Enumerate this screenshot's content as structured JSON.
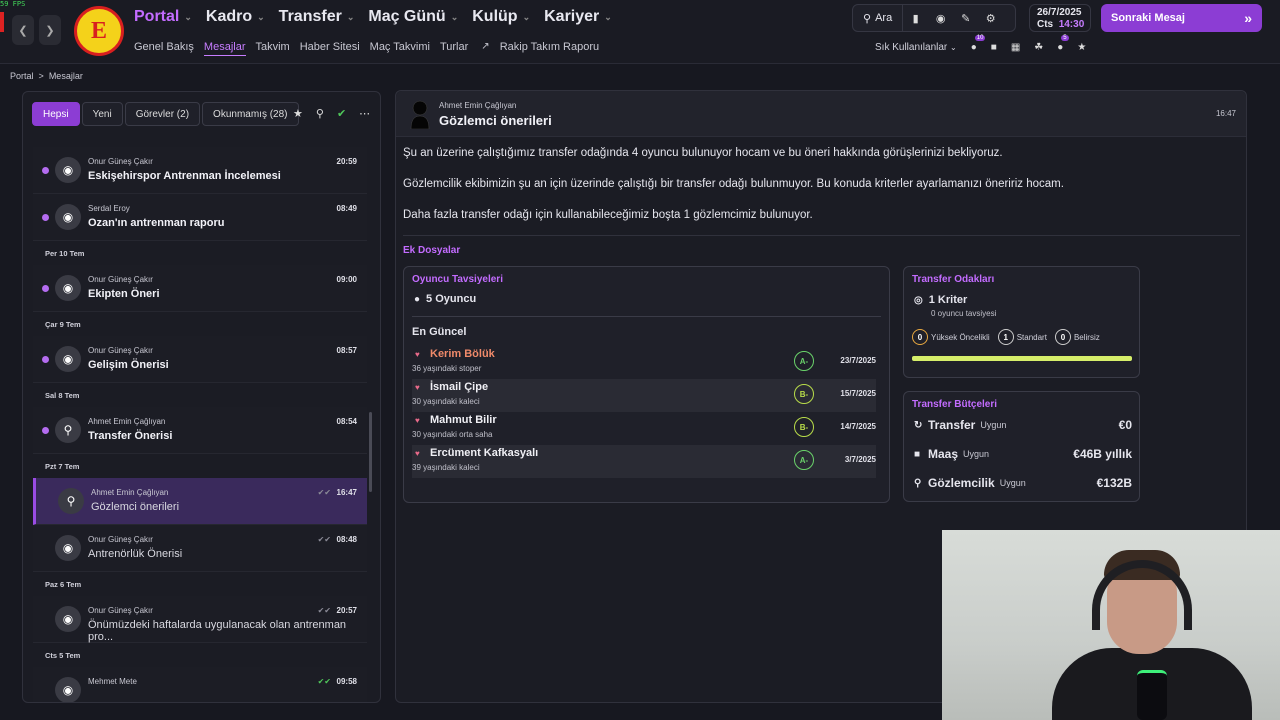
{
  "fps": "59 FPS",
  "nav": {
    "back_icon": "chevron-left-icon",
    "forward_icon": "chevron-right-icon",
    "main": [
      {
        "label": "Portal",
        "active": true
      },
      {
        "label": "Kadro",
        "active": false
      },
      {
        "label": "Transfer",
        "active": false
      },
      {
        "label": "Maç Günü",
        "active": false
      },
      {
        "label": "Kulüp",
        "active": false
      },
      {
        "label": "Kariyer",
        "active": false
      }
    ],
    "sub": [
      {
        "label": "Genel Bakış",
        "active": false
      },
      {
        "label": "Mesajlar",
        "active": true
      },
      {
        "label": "Takvim",
        "active": false
      },
      {
        "label": "Haber Sitesi",
        "active": false
      },
      {
        "label": "Maç Takvimi",
        "active": false
      },
      {
        "label": "Turlar",
        "active": false
      },
      {
        "label": "Rakip Takım Raporu",
        "active": false
      }
    ]
  },
  "toolbar": {
    "search_label": "Ara"
  },
  "date": {
    "date": "26/7/2025",
    "day": "Cts",
    "time": "14:30"
  },
  "next_message": "Sonraki Mesaj",
  "favorites": {
    "label": "Sık Kullanılanlar",
    "badge1": "10",
    "badge2": "5"
  },
  "breadcrumb": {
    "root": "Portal",
    "current": "Mesajlar"
  },
  "inbox": {
    "filters": [
      {
        "label": "Hepsi",
        "active": true
      },
      {
        "label": "Yeni",
        "active": false
      },
      {
        "label": "Görevler (2)",
        "active": false
      },
      {
        "label": "Okunmamış (28)",
        "active": false
      }
    ],
    "items": [
      {
        "type": "msg",
        "from": "Onur Güneş Çakır",
        "subject": "Eskişehirspor Antrenman İncelemesi",
        "time": "20:59",
        "unread": true,
        "icon": "whistle-icon"
      },
      {
        "type": "msg",
        "from": "Serdal Eroy",
        "subject": "Ozan'ın antrenman raporu",
        "time": "08:49",
        "unread": true,
        "icon": "whistle-icon"
      },
      {
        "type": "date",
        "label": "Per 10 Tem"
      },
      {
        "type": "msg",
        "from": "Onur Güneş Çakır",
        "subject": "Ekipten Öneri",
        "time": "09:00",
        "unread": true,
        "icon": "whistle-icon"
      },
      {
        "type": "date",
        "label": "Çar 9 Tem"
      },
      {
        "type": "msg",
        "from": "Onur Güneş Çakır",
        "subject": "Gelişim Önerisi",
        "time": "08:57",
        "unread": true,
        "icon": "whistle-icon"
      },
      {
        "type": "date",
        "label": "Sal 8 Tem"
      },
      {
        "type": "msg",
        "from": "Ahmet Emin Çağlıyan",
        "subject": "Transfer Önerisi",
        "time": "08:54",
        "unread": true,
        "icon": "magnifier-icon"
      },
      {
        "type": "date",
        "label": "Pzt 7 Tem"
      },
      {
        "type": "msg",
        "from": "Ahmet Emin Çağlıyan",
        "subject": "Gözlemci önerileri",
        "time": "16:47",
        "unread": false,
        "selected": true,
        "icon": "magnifier-icon"
      },
      {
        "type": "msg",
        "from": "Onur Güneş Çakır",
        "subject": "Antrenörlük Önerisi",
        "time": "08:48",
        "unread": false,
        "icon": "whistle-icon"
      },
      {
        "type": "date",
        "label": "Paz 6 Tem"
      },
      {
        "type": "msg",
        "from": "Onur Güneş Çakır",
        "subject": "Önümüzdeki haftalarda uygulanacak olan antrenman pro...",
        "time": "20:57",
        "unread": false,
        "icon": "whistle-icon"
      },
      {
        "type": "date",
        "label": "Cts 5 Tem"
      },
      {
        "type": "msg",
        "from": "Mehmet Mete",
        "subject": "",
        "time": "09:58",
        "unread": false,
        "green": true,
        "icon": "whistle-icon"
      }
    ]
  },
  "message": {
    "sender": "Ahmet Emin Çağlıyan",
    "title": "Gözlemci önerileri",
    "time": "16:47",
    "paragraphs": [
      "Şu an üzerine çalıştığımız transfer odağında 4 oyuncu bulunuyor hocam ve bu öneri hakkında görüşlerinizi bekliyoruz.",
      "Gözlemcilik ekibimizin şu an için üzerinde çalıştığı bir transfer odağı bulunmuyor. Bu konuda kriterler ayarlamanızı öneririz hocam.",
      "Daha fazla transfer odağı için kullanabileceğimiz boşta 1 gözlemcimiz bulunuyor."
    ],
    "attachments_label": "Ek Dosyalar",
    "recommendations": {
      "title": "Oyuncu Tavsiyeleri",
      "count": "5 Oyuncu",
      "latest_label": "En Güncel",
      "players": [
        {
          "name": "Kerim Bölük",
          "desc": "36 yaşındaki stoper",
          "grade": "A-",
          "date": "23/7/2025",
          "highlight": true
        },
        {
          "name": "İsmail Çipe",
          "desc": "30 yaşındaki kaleci",
          "grade": "B-",
          "date": "15/7/2025",
          "highlight": false
        },
        {
          "name": "Mahmut Bilir",
          "desc": "30 yaşındaki orta saha",
          "grade": "B-",
          "date": "14/7/2025",
          "highlight": false
        },
        {
          "name": "Ercüment Kafkasyalı",
          "desc": "39 yaşındaki kaleci",
          "grade": "A-",
          "date": "3/7/2025",
          "highlight": false
        }
      ]
    },
    "focus": {
      "title": "Transfer Odakları",
      "criteria": "1 Kriter",
      "sub": "0 oyuncu tavsiyesi",
      "stats": [
        {
          "value": "0",
          "label": "Yüksek Öncelikli"
        },
        {
          "value": "1",
          "label": "Standart"
        },
        {
          "value": "0",
          "label": "Belirsiz"
        }
      ]
    },
    "budgets": {
      "title": "Transfer Bütçeleri",
      "rows": [
        {
          "label": "Transfer",
          "status": "Uygun",
          "value": "€0",
          "icon": "refresh-icon"
        },
        {
          "label": "Maaş",
          "status": "Uygun",
          "value": "€46B yıllık",
          "icon": "shirt-icon"
        },
        {
          "label": "Gözlemcilik",
          "status": "Uygun",
          "value": "€132B",
          "icon": "search-icon"
        }
      ]
    }
  }
}
